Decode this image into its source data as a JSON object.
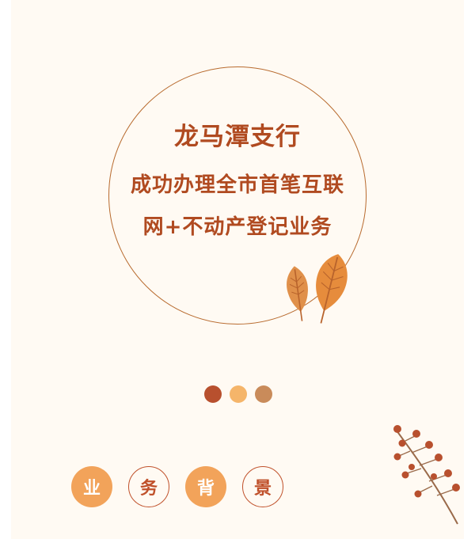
{
  "headline": {
    "title": "龙马潭支行",
    "line1": "成功办理全市首笔互联",
    "line2": "网+不动产登记业务"
  },
  "colors": {
    "background": "#fffaf3",
    "accent_dark": "#b04a20",
    "dot_1": "#b8502e",
    "dot_2": "#f5b56a",
    "dot_3": "#c98b5a",
    "chip_fill": "#f2a35a"
  },
  "section_title": {
    "chars": [
      "业",
      "务",
      "背",
      "景"
    ]
  },
  "decorations": {
    "leaf": "autumn-leaves-icon",
    "branch": "berry-branch-icon"
  }
}
